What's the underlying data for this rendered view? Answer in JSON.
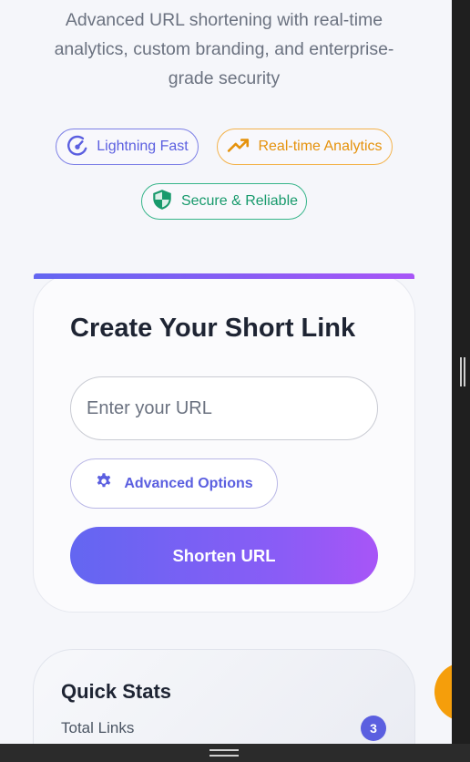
{
  "hero": {
    "subtitle": "Advanced URL shortening with real-time analytics, custom branding, and enterprise-grade security"
  },
  "features": [
    {
      "label": "Lightning Fast",
      "icon": "speedometer-icon",
      "color": "#5b5fe0"
    },
    {
      "label": "Real-time Analytics",
      "icon": "trending-up-icon",
      "color": "#e5920c"
    },
    {
      "label": "Secure & Reliable",
      "icon": "shield-icon",
      "color": "#189a6c"
    }
  ],
  "create_card": {
    "title": "Create Your Short Link",
    "url_placeholder": "Enter your URL",
    "url_value": "",
    "advanced_label": "Advanced Options",
    "advanced_icon": "gear-icon",
    "submit_label": "Shorten URL",
    "accent_gradient": [
      "#6366f1",
      "#a855f7"
    ]
  },
  "quick_stats": {
    "title": "Quick Stats",
    "items": [
      {
        "label": "Total Links",
        "value": "3"
      }
    ]
  },
  "fab": {
    "color": "#f59e0b"
  }
}
